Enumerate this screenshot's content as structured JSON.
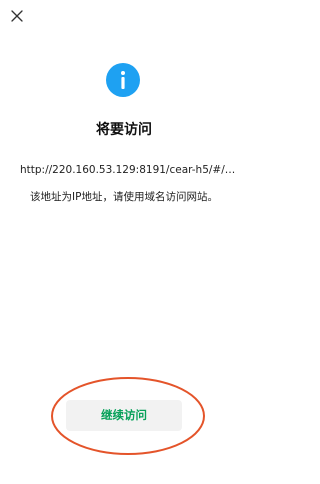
{
  "icons": {
    "close": "close-icon",
    "info": "info-icon"
  },
  "dialog": {
    "title": "将要访问",
    "url": "http://220.160.53.129:8191/cear-h5/#/lo...",
    "notice": "该地址为IP地址，请使用域名访问网站。",
    "continue_label": "继续访问"
  },
  "colors": {
    "info_icon": "#1ea1f2",
    "continue_text": "#07a15a",
    "highlight_ellipse": "#e4542a"
  }
}
